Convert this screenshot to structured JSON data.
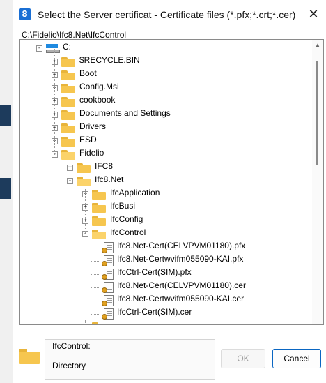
{
  "window": {
    "title": "Select the Server certificat - Certificate files (*.pfx;*.crt;*.cer)",
    "app_icon": "icon-8-app",
    "close_glyph": "✕"
  },
  "path": "C:\\Fidelio\\Ifc8.Net\\IfcControl",
  "tree": {
    "drive": {
      "label": "C:",
      "icon": "drive-icon"
    },
    "root_folders": [
      {
        "label": "$RECYCLE.BIN"
      },
      {
        "label": "Boot"
      },
      {
        "label": "Config.Msi"
      },
      {
        "label": "cookbook"
      },
      {
        "label": "Documents and Settings"
      },
      {
        "label": "Drivers"
      },
      {
        "label": "ESD"
      },
      {
        "label": "Fidelio"
      }
    ],
    "fidelio_children": [
      {
        "label": "IFC8"
      },
      {
        "label": "Ifc8.Net"
      }
    ],
    "ifc8net_children": [
      {
        "label": "IfcApplication"
      },
      {
        "label": "IfcBusi"
      },
      {
        "label": "IfcConfig"
      },
      {
        "label": "IfcControl"
      }
    ],
    "ifccontrol_files": [
      {
        "label": "Ifc8.Net-Cert(CELVPVM01180).pfx"
      },
      {
        "label": "Ifc8.Net-Certwvifm055090-KAI.pfx"
      },
      {
        "label": "IfcCtrl-Cert(SIM).pfx"
      },
      {
        "label": "Ifc8.Net-Cert(CELVPVM01180).cer"
      },
      {
        "label": "Ifc8.Net-Certwvifm055090-KAI.cer"
      },
      {
        "label": "IfcCtrl-Cert(SIM).cer"
      }
    ]
  },
  "info": {
    "name": "IfcControl:",
    "type": "Directory"
  },
  "buttons": {
    "ok": "OK",
    "cancel": "Cancel"
  },
  "colors": {
    "folder": "#f6c64f",
    "accent": "#0a66c2"
  }
}
